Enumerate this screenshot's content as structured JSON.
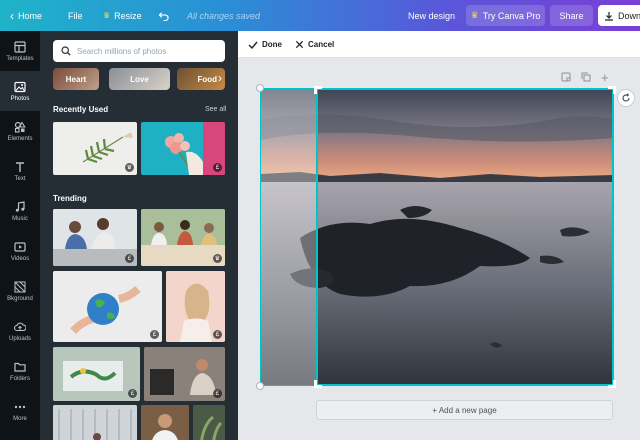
{
  "topbar": {
    "home_label": "Home",
    "file_label": "File",
    "resize_label": "Resize",
    "status_text": "All changes saved",
    "new_design_label": "New design",
    "try_pro_label": "Try Canva Pro",
    "share_label": "Share",
    "download_label": "Down"
  },
  "rail": {
    "items": [
      {
        "label": "Templates",
        "icon": "templates-icon"
      },
      {
        "label": "Photos",
        "icon": "photos-icon"
      },
      {
        "label": "Elements",
        "icon": "elements-icon"
      },
      {
        "label": "Text",
        "icon": "text-icon"
      },
      {
        "label": "Music",
        "icon": "music-icon"
      },
      {
        "label": "Videos",
        "icon": "videos-icon"
      },
      {
        "label": "Bkground",
        "icon": "background-icon"
      },
      {
        "label": "Uploads",
        "icon": "uploads-icon"
      },
      {
        "label": "Folders",
        "icon": "folders-icon"
      },
      {
        "label": "More",
        "icon": "more-icon"
      }
    ]
  },
  "panel": {
    "search_placeholder": "Search millions of photos",
    "categories": [
      "Heart",
      "Love",
      "Food"
    ],
    "recent_title": "Recently Used",
    "see_all": "See all",
    "trending_title": "Trending",
    "badge_pro": "♛",
    "badge_free": "£"
  },
  "crop_toolbar": {
    "done_label": "Done",
    "cancel_label": "Cancel"
  },
  "canvas": {
    "add_page_label": "+ Add a new page"
  },
  "colors": {
    "accent": "#00c4cc",
    "rail_bg": "#0e1318",
    "panel_bg": "#252d35"
  }
}
